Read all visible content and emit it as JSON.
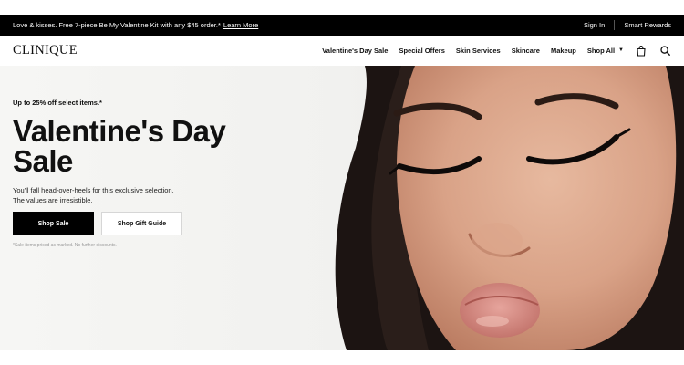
{
  "promo": {
    "text": "Love & kisses. Free 7-piece Be My Valentine Kit with any $45 order.*",
    "link": "Learn More",
    "sign_in": "Sign In",
    "rewards": "Smart Rewards"
  },
  "header": {
    "logo": "CLINIQUE",
    "nav": [
      "Valentine's Day Sale",
      "Special Offers",
      "Skin Services",
      "Skincare",
      "Makeup",
      "Shop All"
    ],
    "icons": [
      "shopping-bag-icon",
      "search-icon"
    ]
  },
  "hero": {
    "eyebrow": "Up to 25% off select items.*",
    "headline_line1": "Valentine's Day",
    "headline_line2": "Sale",
    "sub_line1": "You'll fall head-over-heels for this exclusive selection.",
    "sub_line2": "The values are irresistible.",
    "cta_primary": "Shop Sale",
    "cta_secondary": "Shop Gift Guide",
    "disclaimer": "*Sale items priced as marked. No further discounts."
  },
  "colors": {
    "promo_bg": "#000000",
    "primary_button": "#000000",
    "hero_bg": "#f4f4f2"
  }
}
